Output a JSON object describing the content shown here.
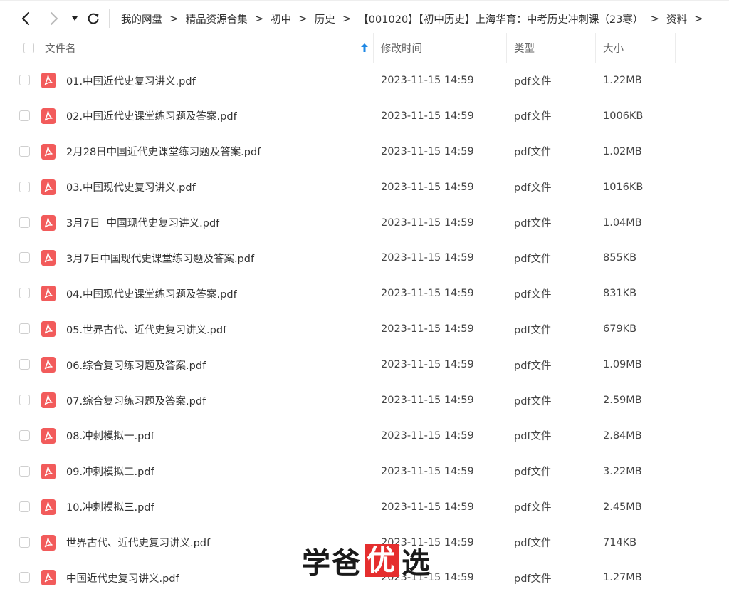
{
  "toolbar": {
    "back_icon": "chevron-left-icon",
    "forward_icon": "chevron-right-icon",
    "history_icon": "caret-down-icon",
    "refresh_icon": "refresh-icon"
  },
  "breadcrumb": [
    "我的网盘",
    "精品资源合集",
    "初中",
    "历史",
    "【001020】【初中历史】上海华育：中考历史冲刺课（23寒）",
    "资料"
  ],
  "columns": {
    "name": "文件名",
    "modified": "修改时间",
    "type": "类型",
    "size": "大小",
    "sort_icon": "arrow-up-icon"
  },
  "files": [
    {
      "name": "01.中国近代史复习讲义.pdf",
      "modified": "2023-11-15 14:59",
      "type": "pdf文件",
      "size": "1.22MB"
    },
    {
      "name": "02.中国近代史课堂练习题及答案.pdf",
      "modified": "2023-11-15 14:59",
      "type": "pdf文件",
      "size": "1006KB"
    },
    {
      "name": "2月28日中国近代史课堂练习题及答案.pdf",
      "modified": "2023-11-15 14:59",
      "type": "pdf文件",
      "size": "1.02MB"
    },
    {
      "name": "03.中国现代史复习讲义.pdf",
      "modified": "2023-11-15 14:59",
      "type": "pdf文件",
      "size": "1016KB"
    },
    {
      "name": "3月7日  中国现代史复习讲义.pdf",
      "modified": "2023-11-15 14:59",
      "type": "pdf文件",
      "size": "1.04MB"
    },
    {
      "name": "3月7日中国现代史课堂练习题及答案.pdf",
      "modified": "2023-11-15 14:59",
      "type": "pdf文件",
      "size": "855KB"
    },
    {
      "name": "04.中国现代史课堂练习题及答案.pdf",
      "modified": "2023-11-15 14:59",
      "type": "pdf文件",
      "size": "831KB"
    },
    {
      "name": "05.世界古代、近代史复习讲义.pdf",
      "modified": "2023-11-15 14:59",
      "type": "pdf文件",
      "size": "679KB"
    },
    {
      "name": "06.综合复习练习题及答案.pdf",
      "modified": "2023-11-15 14:59",
      "type": "pdf文件",
      "size": "1.09MB"
    },
    {
      "name": "07.综合复习练习题及答案.pdf",
      "modified": "2023-11-15 14:59",
      "type": "pdf文件",
      "size": "2.59MB"
    },
    {
      "name": "08.冲刺模拟一.pdf",
      "modified": "2023-11-15 14:59",
      "type": "pdf文件",
      "size": "2.84MB"
    },
    {
      "name": "09.冲刺模拟二.pdf",
      "modified": "2023-11-15 14:59",
      "type": "pdf文件",
      "size": "3.22MB"
    },
    {
      "name": "10.冲刺模拟三.pdf",
      "modified": "2023-11-15 14:59",
      "type": "pdf文件",
      "size": "2.45MB"
    },
    {
      "name": "世界古代、近代史复习讲义.pdf",
      "modified": "2023-11-15 14:59",
      "type": "pdf文件",
      "size": "714KB"
    },
    {
      "name": "中国近代史复习讲义.pdf",
      "modified": "2023-11-15 14:59",
      "type": "pdf文件",
      "size": "1.27MB"
    }
  ],
  "watermark": {
    "part1": "学爸",
    "part2": "优",
    "part3": "选",
    "highlight_color": "#e52e2e"
  },
  "colors": {
    "pdf_icon": "#f25b5b",
    "sort_arrow": "#1e88e5"
  }
}
